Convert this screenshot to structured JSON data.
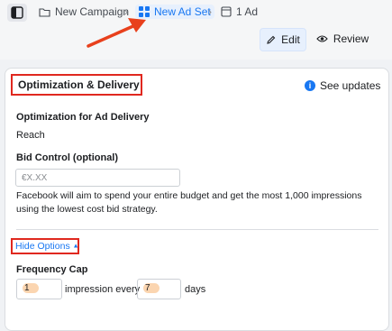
{
  "breadcrumb": {
    "items": [
      {
        "label": "New Campaign",
        "icon": "folder-icon"
      },
      {
        "label": "New Ad Set",
        "icon": "grid-icon"
      },
      {
        "label": "1 Ad",
        "icon": "ad-icon"
      }
    ]
  },
  "toolbar": {
    "edit_label": "Edit",
    "review_label": "Review"
  },
  "section": {
    "title": "Optimization & Delivery",
    "see_updates_label": "See updates"
  },
  "optimization": {
    "label": "Optimization for Ad Delivery",
    "value": "Reach"
  },
  "bid_control": {
    "label": "Bid Control (optional)",
    "placeholder": "€X.XX"
  },
  "description": "Facebook will aim to spend your entire budget and get the most 1,000 impressions using the lowest cost bid strategy.",
  "hide_options_label": "Hide Options",
  "frequency_cap": {
    "label": "Frequency Cap",
    "impressions_value": "1",
    "impressions_text": "impression every",
    "days_value": "7",
    "days_text": "days"
  },
  "colors": {
    "accent": "#1877f2",
    "highlight_box": "#e0281f",
    "arrow": "#e8401c"
  }
}
